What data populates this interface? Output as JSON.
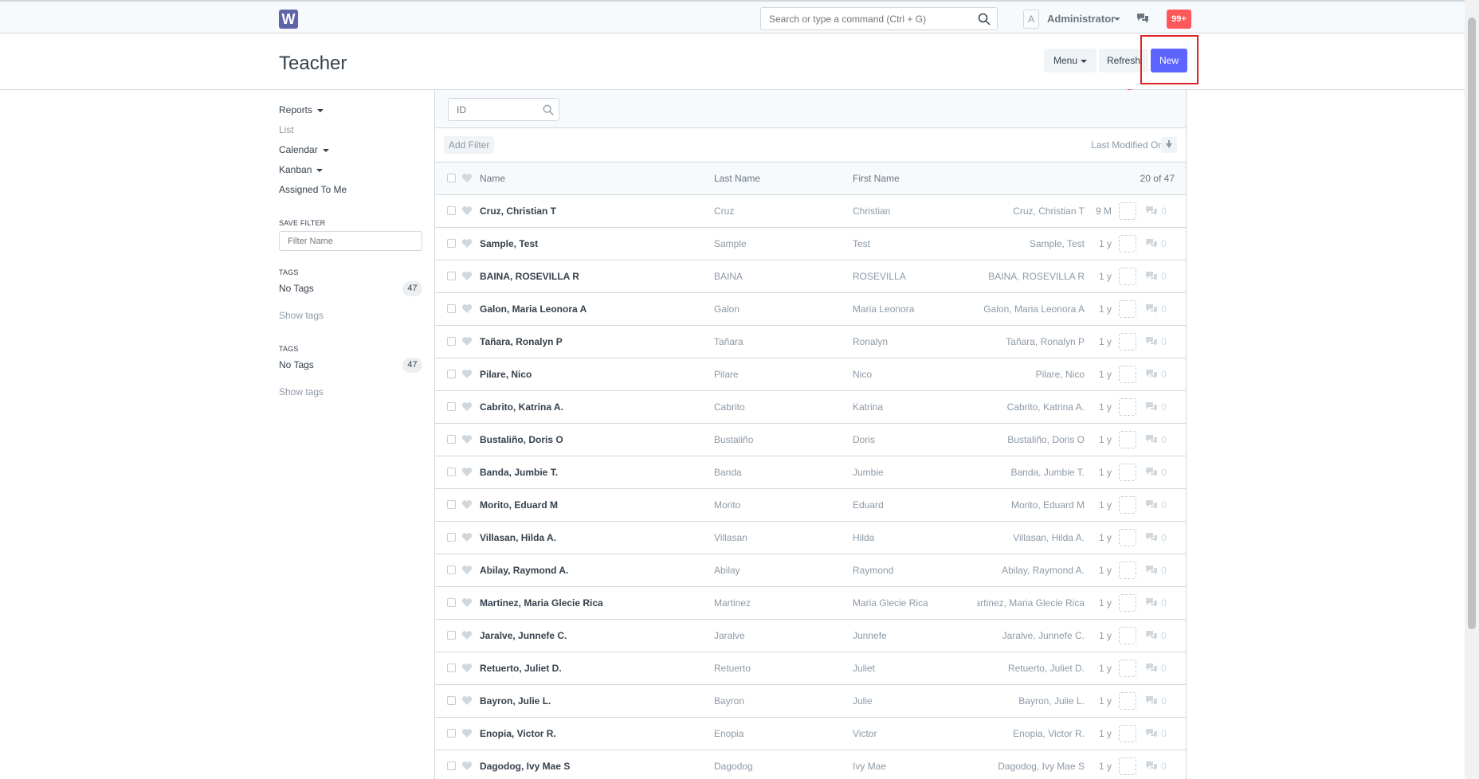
{
  "navbar": {
    "logo_letter": "W",
    "search_placeholder": "Search or type a command (Ctrl + G)",
    "avatar_letter": "A",
    "user_name": "Administrator",
    "notification_count": "99+"
  },
  "page": {
    "title": "Teacher",
    "menu_label": "Menu",
    "refresh_label": "Refresh",
    "new_label": "New"
  },
  "sidebar": {
    "reports": "Reports",
    "list": "List",
    "calendar": "Calendar",
    "kanban": "Kanban",
    "assigned": "Assigned To Me",
    "save_filter_label": "SAVE FILTER",
    "filter_placeholder": "Filter Name",
    "tags_label_1": "TAGS",
    "no_tags_1": "No Tags",
    "no_tags_count_1": "47",
    "show_tags_1": "Show tags",
    "tags_label_2": "TAGS",
    "no_tags_2": "No Tags",
    "no_tags_count_2": "47",
    "show_tags_2": "Show tags"
  },
  "list": {
    "id_placeholder": "ID",
    "add_filter": "Add Filter",
    "sort_label": "Last Modified On",
    "headers": {
      "name": "Name",
      "last": "Last Name",
      "first": "First Name",
      "count": "20 of 47"
    },
    "rows": [
      {
        "name": "Cruz, Christian T",
        "last": "Cruz",
        "first": "Christian",
        "title": "Cruz, Christian T",
        "modified": "9 M",
        "comments": "0"
      },
      {
        "name": "Sample, Test",
        "last": "Sample",
        "first": "Test",
        "title": "Sample, Test",
        "modified": "1 y",
        "comments": "0"
      },
      {
        "name": "BAINA, ROSEVILLA R",
        "last": "BAINA",
        "first": "ROSEVILLA",
        "title": "BAINA, ROSEVILLA R",
        "modified": "1 y",
        "comments": "0"
      },
      {
        "name": "Galon, Maria Leonora A",
        "last": "Galon",
        "first": "Maria Leonora",
        "title": "Galon, Maria Leonora A",
        "modified": "1 y",
        "comments": "0"
      },
      {
        "name": "Tañara, Ronalyn P",
        "last": "Tañara",
        "first": "Ronalyn",
        "title": "Tañara, Ronalyn P",
        "modified": "1 y",
        "comments": "0"
      },
      {
        "name": "Pilare, Nico",
        "last": "Pilare",
        "first": "Nico",
        "title": "Pilare, Nico",
        "modified": "1 y",
        "comments": "0"
      },
      {
        "name": "Cabrito, Katrina A.",
        "last": "Cabrito",
        "first": "Katrina",
        "title": "Cabrito, Katrina A.",
        "modified": "1 y",
        "comments": "0"
      },
      {
        "name": "Bustaliño, Doris O",
        "last": "Bustaliño",
        "first": "Doris",
        "title": "Bustaliño, Doris O",
        "modified": "1 y",
        "comments": "0"
      },
      {
        "name": "Banda, Jumbie T.",
        "last": "Banda",
        "first": "Jumbie",
        "title": "Banda, Jumbie T.",
        "modified": "1 y",
        "comments": "0"
      },
      {
        "name": "Morito, Eduard M",
        "last": "Morito",
        "first": "Eduard",
        "title": "Morito, Eduard M",
        "modified": "1 y",
        "comments": "0"
      },
      {
        "name": "Villasan, Hilda A.",
        "last": "Villasan",
        "first": "Hilda",
        "title": "Villasan, Hilda A.",
        "modified": "1 y",
        "comments": "0"
      },
      {
        "name": "Abilay, Raymond A.",
        "last": "Abilay",
        "first": "Raymond",
        "title": "Abilay, Raymond A.",
        "modified": "1 y",
        "comments": "0"
      },
      {
        "name": "Martinez, Maria Glecie Rica",
        "last": "Martinez",
        "first": "Maria Glecie Rica",
        "title": "Martinez, Maria Glecie Rica",
        "modified": "1 y",
        "comments": "0"
      },
      {
        "name": "Jaralve, Junnefe C.",
        "last": "Jaralve",
        "first": "Junnefe",
        "title": "Jaralve, Junnefe C.",
        "modified": "1 y",
        "comments": "0"
      },
      {
        "name": "Retuerto, Juliet D.",
        "last": "Retuerto",
        "first": "Juliet",
        "title": "Retuerto, Juliet D.",
        "modified": "1 y",
        "comments": "0"
      },
      {
        "name": "Bayron, Julie L.",
        "last": "Bayron",
        "first": "Julie",
        "title": "Bayron, Julie L.",
        "modified": "1 y",
        "comments": "0"
      },
      {
        "name": "Enopia, Victor R.",
        "last": "Enopia",
        "first": "Victor",
        "title": "Enopia, Victor R.",
        "modified": "1 y",
        "comments": "0"
      },
      {
        "name": "Dagodog, Ivy Mae S",
        "last": "Dagodog",
        "first": "Ivy Mae",
        "title": "Dagodog, Ivy Mae S",
        "modified": "1 y",
        "comments": "0"
      }
    ]
  },
  "colors": {
    "primary": "#5e64ff",
    "notification": "#ff5858",
    "annotation": "#e02020"
  }
}
